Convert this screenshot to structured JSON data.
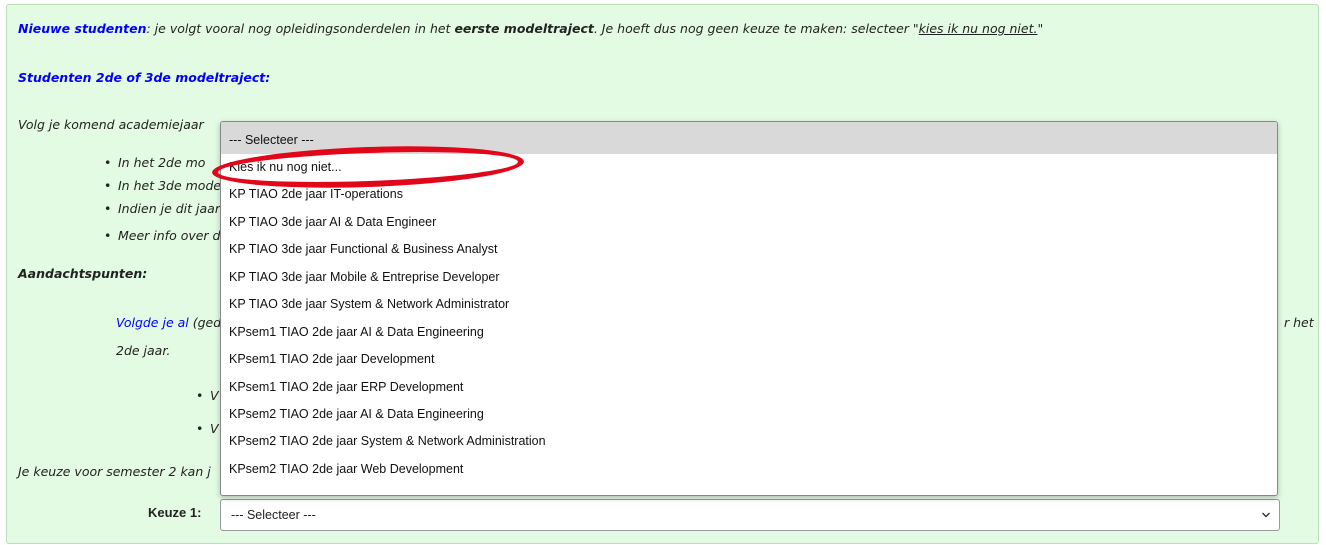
{
  "intro": {
    "new_students_label": "Nieuwe studenten",
    "new_students_text_a": ": je volgt vooral nog opleidingsonderdelen in het ",
    "new_students_bold": "eerste modeltraject",
    "new_students_text_b": ". Je hoeft dus nog geen keuze te maken: selecteer \"",
    "new_students_link": "kies ik nu nog niet.",
    "new_students_text_c": "\""
  },
  "section_23": {
    "heading": "Studenten 2de of 3de modeltraject:",
    "follow_text": "Volg je komend academiejaar",
    "bullets": [
      "In het 2de mo",
      "In het 3de mode",
      "Indien je dit jaar",
      "Meer info over d"
    ]
  },
  "aandacht": {
    "heading": "Aandachtspunten:",
    "para_blue": "Volgde je al",
    "para_text": "(ged",
    "para_end": "r het",
    "para_line2": "2de jaar.",
    "sub_bullets": [
      "V",
      "V"
    ]
  },
  "semester_text": "Je keuze voor semester 2 kan j",
  "keuze": {
    "label": "Keuze 1:",
    "selected_value": "--- Selecteer ---"
  },
  "dropdown": {
    "options": [
      "--- Selecteer ---",
      "Kies ik nu nog niet...",
      "KP TIAO 2de jaar IT-operations",
      "KP TIAO 3de jaar AI & Data Engineer",
      "KP TIAO 3de jaar Functional & Business Analyst",
      "KP TIAO 3de jaar Mobile & Entreprise Developer",
      "KP TIAO 3de jaar System & Network Administrator",
      "KPsem1 TIAO 2de jaar AI & Data Engineering",
      "KPsem1 TIAO 2de jaar Development",
      "KPsem1 TIAO 2de jaar ERP Development",
      "KPsem2 TIAO 2de jaar AI & Data Engineering",
      "KPsem2 TIAO 2de jaar System & Network Administration",
      "KPsem2 TIAO 2de jaar Web Development"
    ]
  },
  "colors": {
    "panel_bg": "#e3fbe3",
    "link_blue": "#0000ff",
    "annotation_red": "#e2061b",
    "highlight_grey": "#d9d9d9"
  }
}
